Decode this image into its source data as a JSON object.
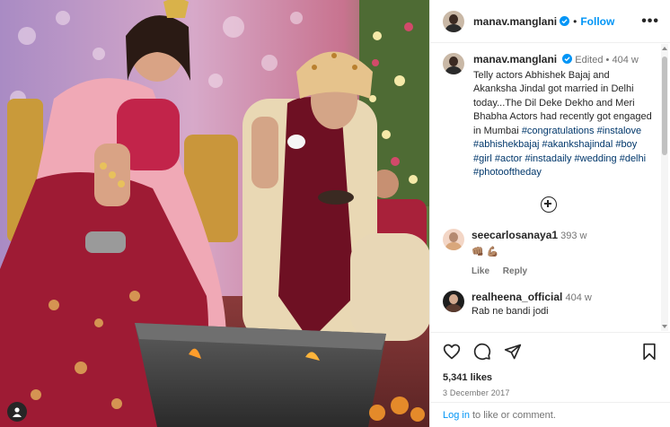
{
  "post": {
    "author": "manav.manglani",
    "follow_label": "Follow",
    "separator": "•",
    "more_label": "•••",
    "verified_color": "#0095f6"
  },
  "caption": {
    "username": "manav.manglani",
    "edited_label": "Edited",
    "separator": "•",
    "age": "404 w",
    "text": "Telly actors Abhishek Bajaj and Akanksha Jindal got married in Delhi today...The Dil Deke Dekho and Meri Bhabha Actors had recently got engaged in Mumbai",
    "hashtags": [
      "#congratulations",
      "#instalove",
      "#abhishekbajaj",
      "#akankshajindal",
      "#boy",
      "#girl",
      "#actor",
      "#instadaily",
      "#wedding",
      "#delhi",
      "#photooftheday"
    ]
  },
  "comments": [
    {
      "username": "seecarlosanaya1",
      "age": "393 w",
      "text": "👊🏽 💪🏽",
      "like_label": "Like",
      "reply_label": "Reply"
    },
    {
      "username": "realheena_official",
      "age": "404 w",
      "text": "Rab ne bandi jodi"
    }
  ],
  "stats": {
    "likes": "5,341 likes",
    "date": "3 December 2017"
  },
  "login": {
    "link_label": "Log in",
    "rest_text": "to like or comment."
  },
  "icons": {
    "like": "heart-icon",
    "comment": "comment-icon",
    "share": "share-icon",
    "save": "bookmark-icon",
    "load_more": "plus-circle-icon",
    "user_tags": "user-icon",
    "more": "more-icon"
  },
  "colors": {
    "link": "#0095f6",
    "hashtag": "#00376b",
    "muted": "#737373",
    "text": "#262626"
  }
}
